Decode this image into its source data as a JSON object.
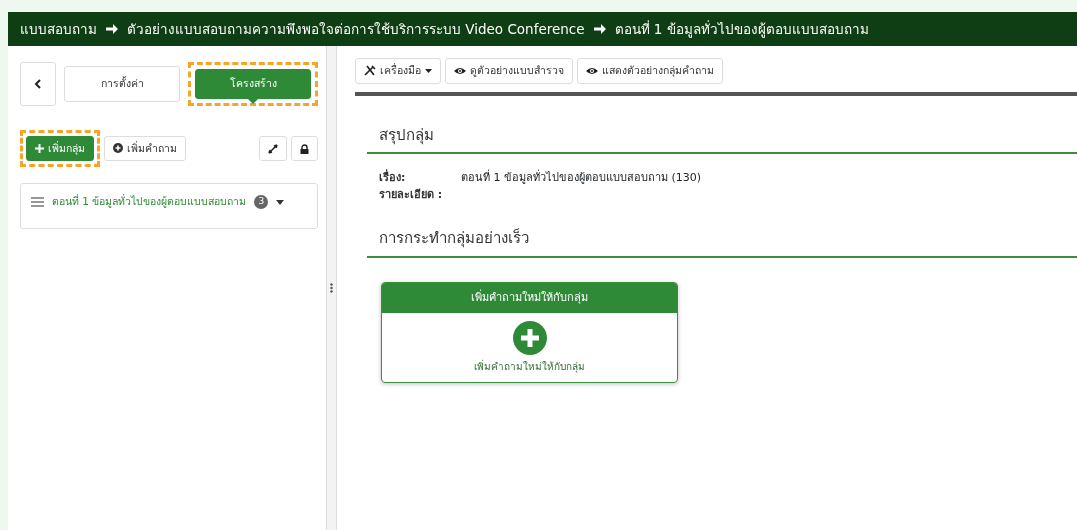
{
  "breadcrumb": [
    "แบบสอบถาม",
    "ตัวอย่างแบบสอบถามความพึงพอใจต่อการใช้บริการระบบ Video Conference",
    "ตอนที่ 1 ข้อมูลทั่วไปของผู้ตอบแบบสอบถาม"
  ],
  "sidebar": {
    "tabs": [
      {
        "label": "การตั้งค่า",
        "selected": false,
        "highlighted": false
      },
      {
        "label": "โครงสร้าง",
        "selected": true,
        "highlighted": true
      }
    ],
    "actions": [
      {
        "label": "เพิ่มกลุ่ม",
        "kind": "plus",
        "primary": true,
        "highlighted": true
      },
      {
        "label": "เพิ่มคำถาม",
        "kind": "circle-plus",
        "primary": false,
        "highlighted": false
      }
    ],
    "groups": [
      {
        "label": "ตอนที่ 1 ข้อมูลทั่วไปของผู้ตอบแบบสอบถาม",
        "count": "3"
      }
    ]
  },
  "toolbar": [
    {
      "label": "เครื่องมือ",
      "kind": "tools"
    },
    {
      "label": "ดูตัวอย่างแบบสำรวจ",
      "kind": "eye"
    },
    {
      "label": "แสดงตัวอย่างกลุ่มคำถาม",
      "kind": "eye"
    }
  ],
  "summary": {
    "title": "สรุปกลุ่ม",
    "fields": [
      {
        "label": "เรื่อง:",
        "value": "ตอนที่ 1 ข้อมูลทั่วไปของผู้ตอบแบบสอบถาม (130)"
      },
      {
        "label": "รายละเอียด :"
      }
    ]
  },
  "quick_actions": {
    "title": "การกระทำกลุ่มอย่างเร็ว",
    "cards": [
      {
        "header": "เพิ่มคำถามใหม่ให้กับกลุ่ม",
        "caption": "เพิ่มคำถามใหม่ให้กับกลุ่ม"
      }
    ]
  }
}
